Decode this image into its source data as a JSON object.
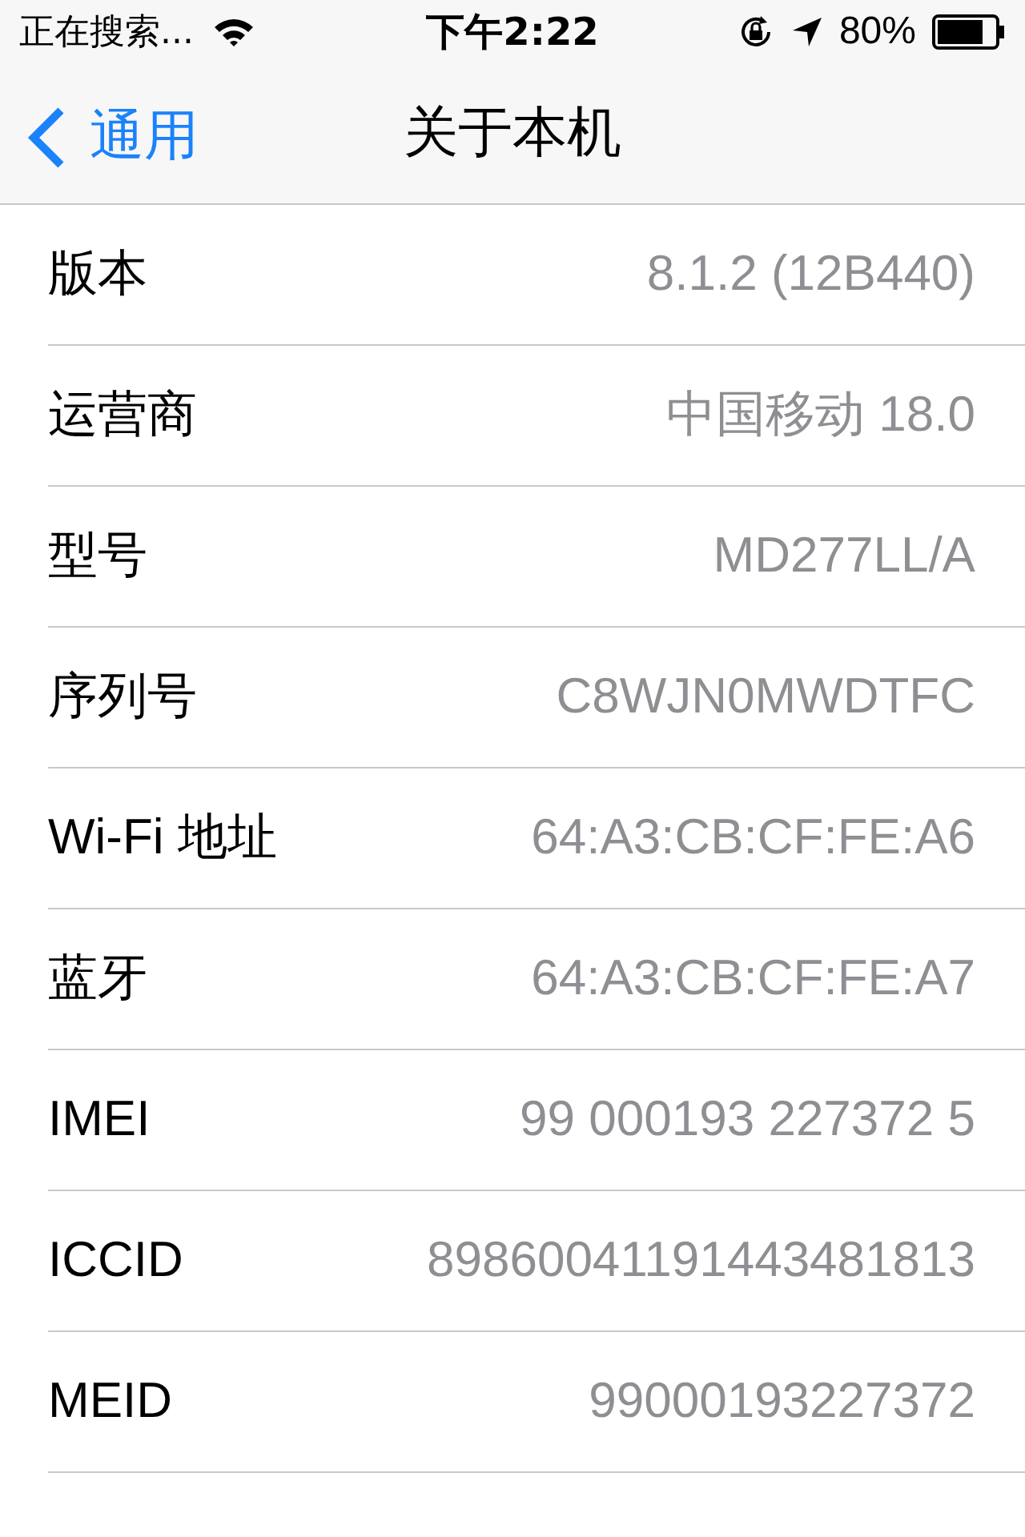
{
  "status_bar": {
    "carrier": "正在搜索...",
    "time": "下午2:22",
    "battery": "80%"
  },
  "nav": {
    "back": "通用",
    "title": "关于本机"
  },
  "rows": [
    {
      "label": "版本",
      "value": "8.1.2 (12B440)"
    },
    {
      "label": "运营商",
      "value": "中国移动 18.0"
    },
    {
      "label": "型号",
      "value": "MD277LL/A"
    },
    {
      "label": "序列号",
      "value": "C8WJN0MWDTFC"
    },
    {
      "label": "Wi-Fi 地址",
      "value": "64:A3:CB:CF:FE:A6"
    },
    {
      "label": "蓝牙",
      "value": "64:A3:CB:CF:FE:A7"
    },
    {
      "label": "IMEI",
      "value": "99 000193 227372 5"
    },
    {
      "label": "ICCID",
      "value": "89860041191443481813"
    },
    {
      "label": "MEID",
      "value": "99000193227372"
    }
  ]
}
